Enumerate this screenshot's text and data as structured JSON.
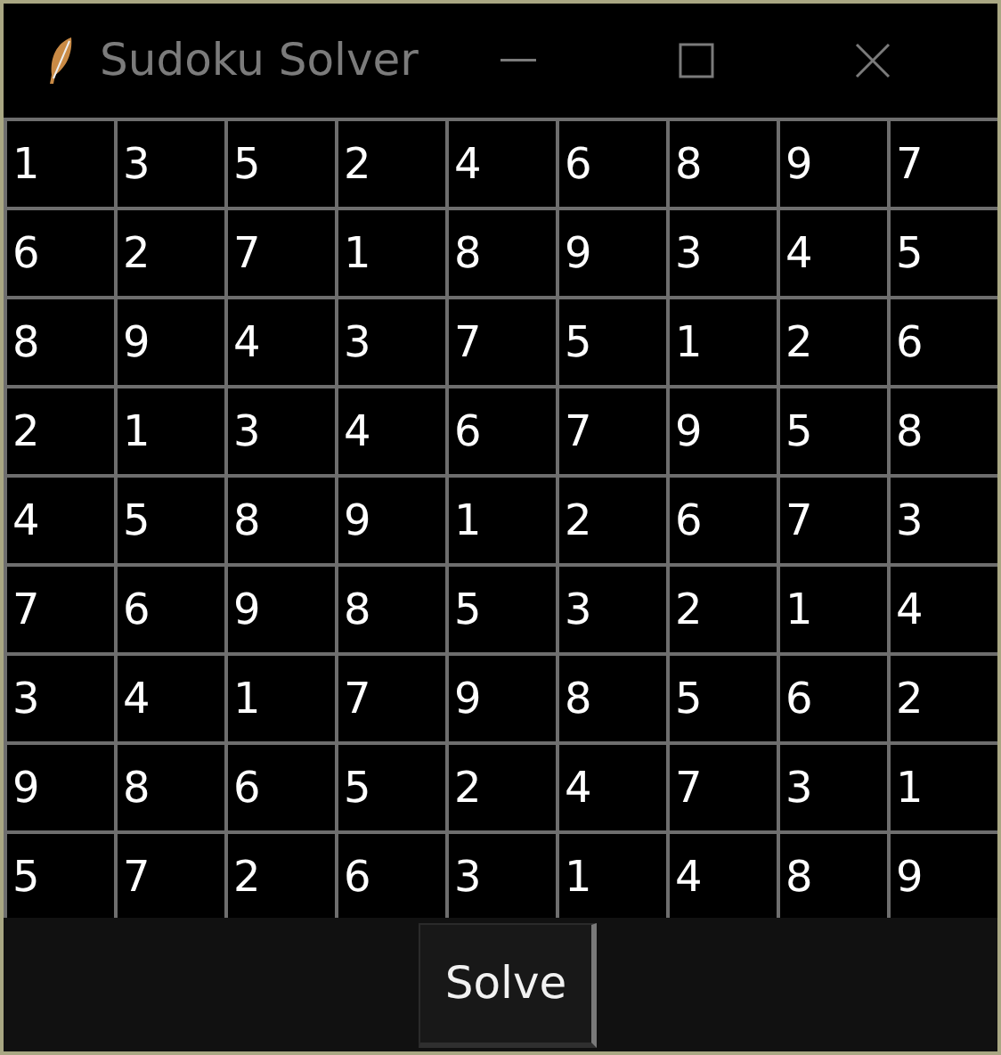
{
  "window": {
    "title": "Sudoku Solver"
  },
  "grid": [
    [
      "1",
      "3",
      "5",
      "2",
      "4",
      "6",
      "8",
      "9",
      "7"
    ],
    [
      "6",
      "2",
      "7",
      "1",
      "8",
      "9",
      "3",
      "4",
      "5"
    ],
    [
      "8",
      "9",
      "4",
      "3",
      "7",
      "5",
      "1",
      "2",
      "6"
    ],
    [
      "2",
      "1",
      "3",
      "4",
      "6",
      "7",
      "9",
      "5",
      "8"
    ],
    [
      "4",
      "5",
      "8",
      "9",
      "1",
      "2",
      "6",
      "7",
      "3"
    ],
    [
      "7",
      "6",
      "9",
      "8",
      "5",
      "3",
      "2",
      "1",
      "4"
    ],
    [
      "3",
      "4",
      "1",
      "7",
      "9",
      "8",
      "5",
      "6",
      "2"
    ],
    [
      "9",
      "8",
      "6",
      "5",
      "2",
      "4",
      "7",
      "3",
      "1"
    ],
    [
      "5",
      "7",
      "2",
      "6",
      "3",
      "1",
      "4",
      "8",
      "9"
    ]
  ],
  "button": {
    "label": "Solve"
  }
}
